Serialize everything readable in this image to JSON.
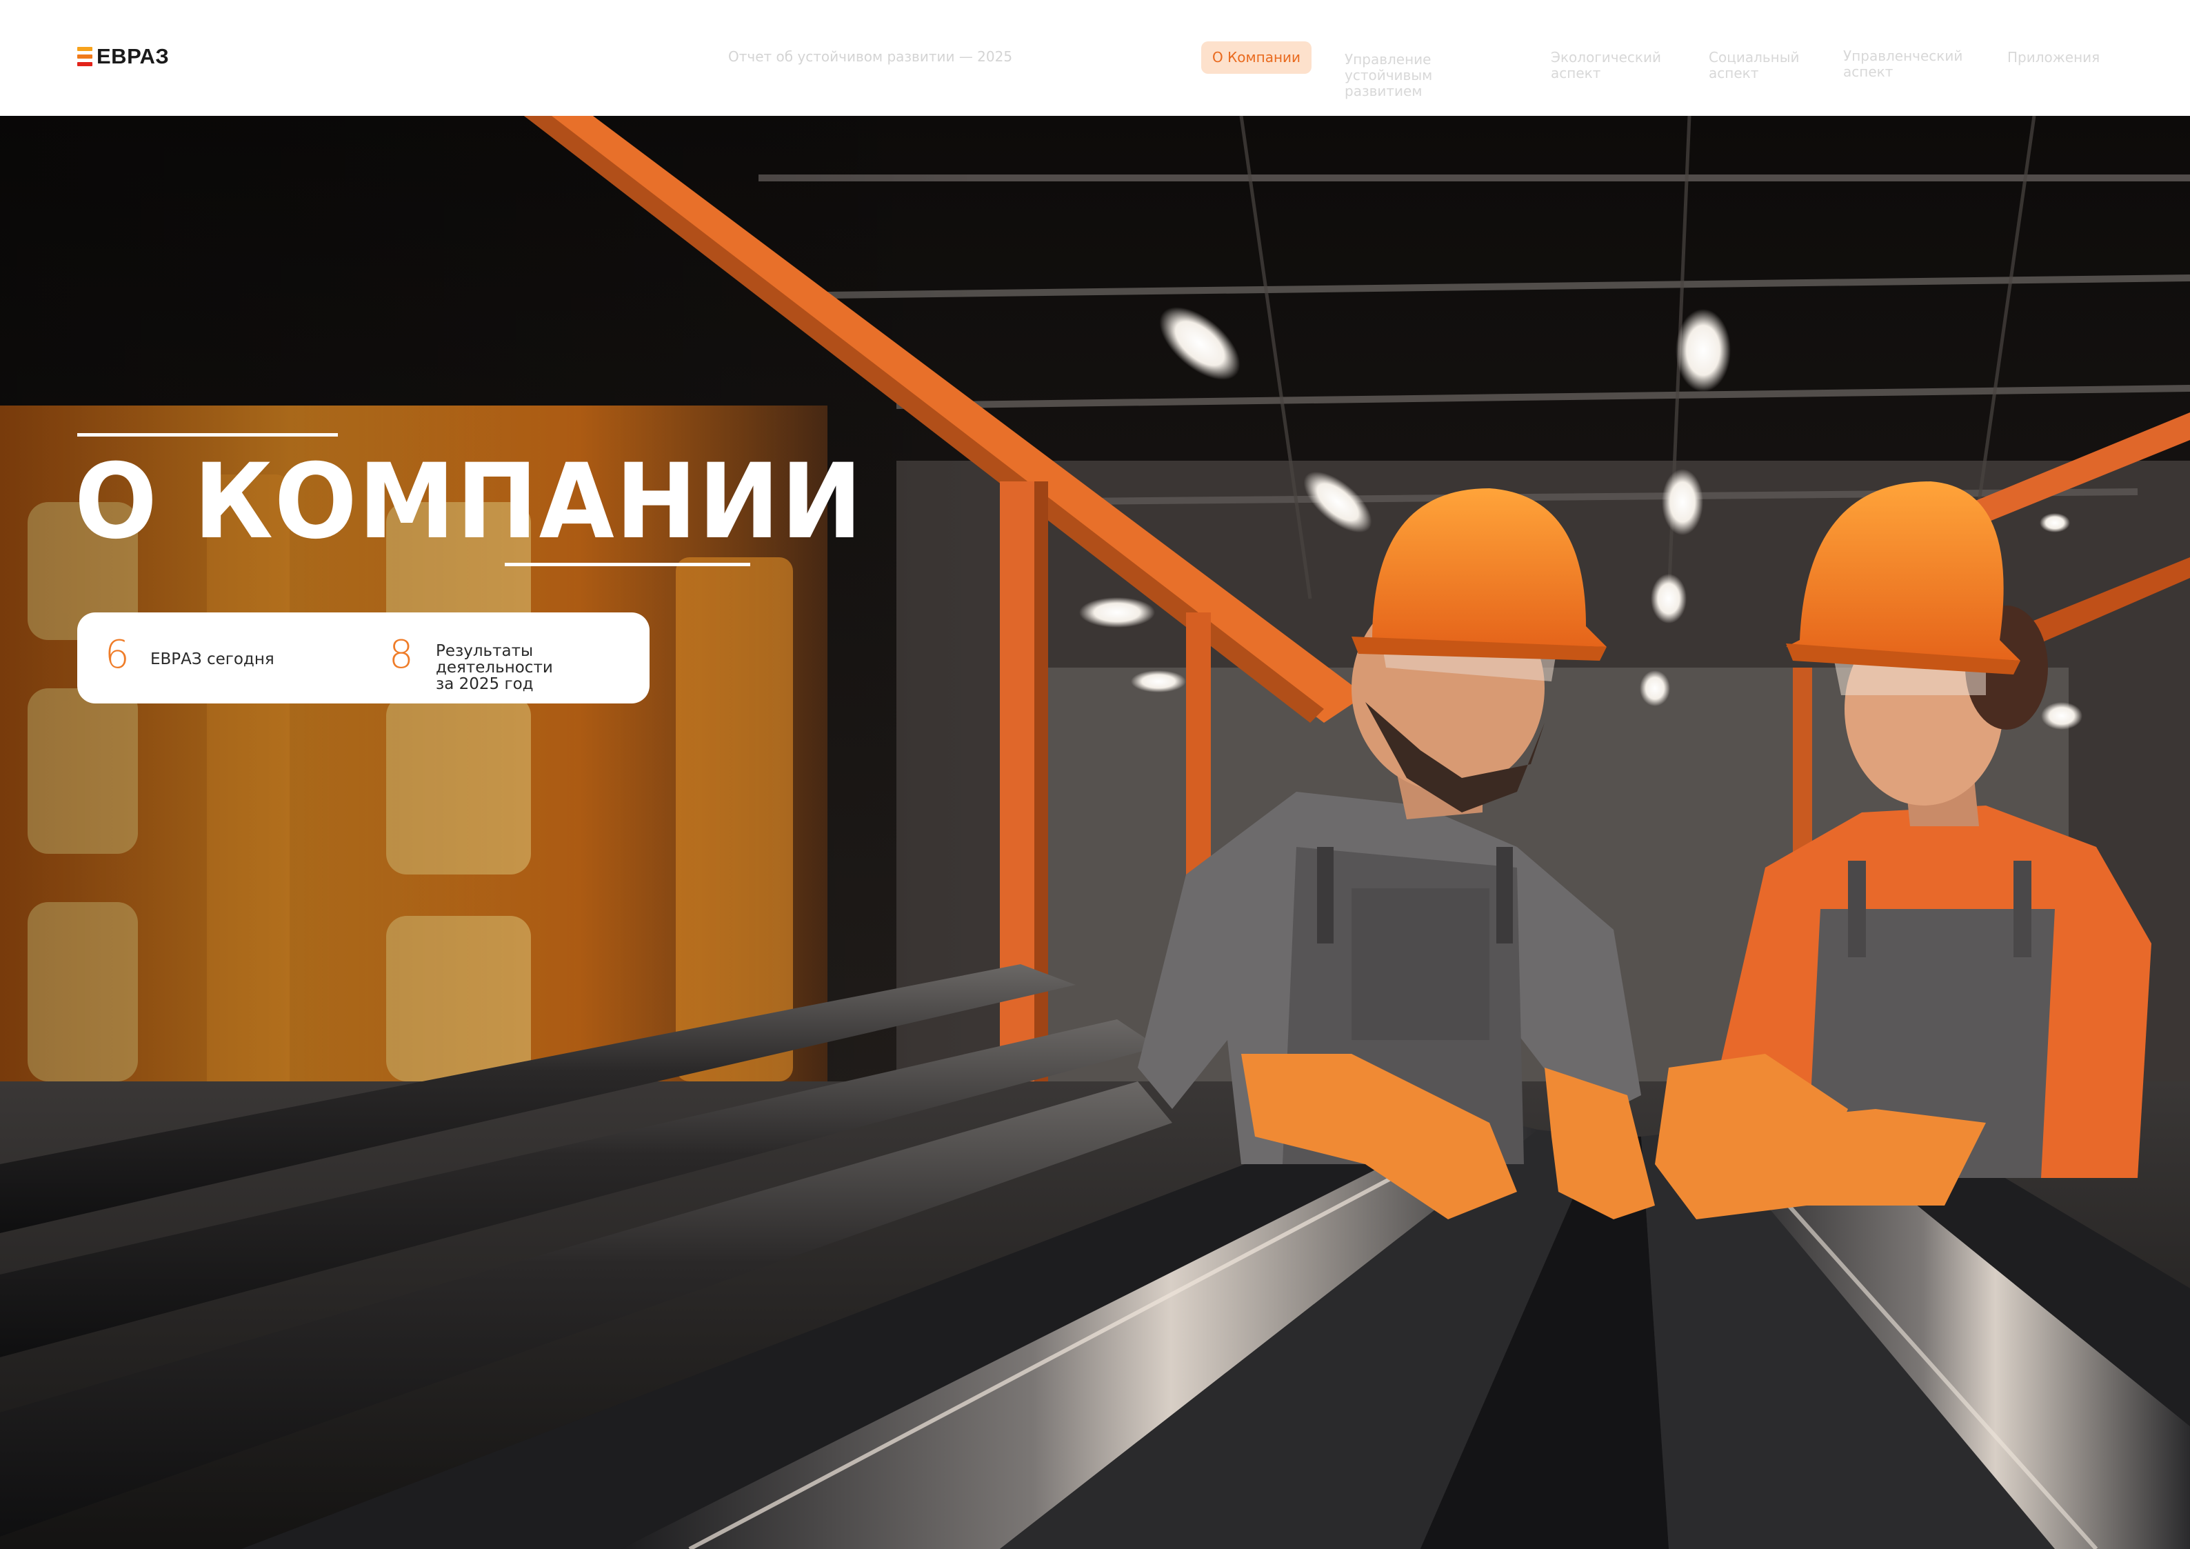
{
  "header": {
    "logo_text": "ЕВРАЗ",
    "report_title": "Отчет об устойчивом развитии — 2025",
    "nav": [
      {
        "label": "О Компании",
        "active": true
      },
      {
        "label": "Управление\nустойчивым развитием",
        "active": false
      },
      {
        "label": "Экологический\nаспект",
        "active": false
      },
      {
        "label": "Социальный\nаспект",
        "active": false
      },
      {
        "label": "Управленческий\nаспект",
        "active": false
      },
      {
        "label": "Приложения",
        "active": false
      }
    ]
  },
  "hero": {
    "title": "О КОМПАНИИ",
    "toc": [
      {
        "page": "6",
        "label": "ЕВРАЗ сегодня"
      },
      {
        "page": "8",
        "label": "Результаты деятельности\nза 2025 год"
      }
    ]
  },
  "colors": {
    "accent": "#ef7c28",
    "active_tab_bg": "#fde1cc",
    "logo_stripes": [
      "#f7a21b",
      "#f07a1a",
      "#e2231a"
    ]
  }
}
